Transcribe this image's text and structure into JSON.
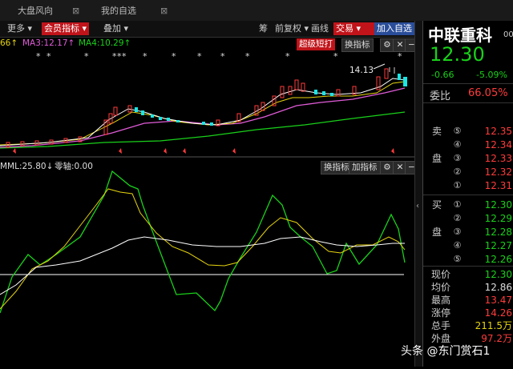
{
  "tabs": [
    {
      "label": "大盘风向",
      "close": "⊠"
    },
    {
      "label": "我的自选",
      "close": "⊠"
    }
  ],
  "toolbar": {
    "more": "更多",
    "member_indicator": "会员指标",
    "overlay": "叠加",
    "simplify": "筹",
    "restore": "前复权",
    "draw_line": "画线",
    "trade": "交易",
    "add_watch": "加入自选"
  },
  "main_chart": {
    "ma_partial": "66↑",
    "ma3": "MA3:12.17↑",
    "ma4": "MA4:10.29↑",
    "super_top": "超级短打",
    "switch_indicator": "换指标",
    "high_label": "14.13",
    "star": "*"
  },
  "indicator": {
    "mml": "MML:25.80↓",
    "zero_axis": "零轴:0.00",
    "switch_indicator": "换指标",
    "add_indicator": "加指标"
  },
  "quote": {
    "name": "中联重科",
    "code_partial": "00",
    "price": "12.30",
    "change": "-0.66",
    "change_pct": "-5.09%",
    "ratio_label": "委比",
    "ratio_value": "66.05%",
    "sell_label_1": "卖",
    "sell_label_2": "盘",
    "buy_label_1": "买",
    "buy_label_2": "盘",
    "asks": [
      {
        "level": "⑤",
        "price": "12.35"
      },
      {
        "level": "④",
        "price": "12.34"
      },
      {
        "level": "③",
        "price": "12.33"
      },
      {
        "level": "②",
        "price": "12.32"
      },
      {
        "level": "①",
        "price": "12.31"
      }
    ],
    "bids": [
      {
        "level": "①",
        "price": "12.30"
      },
      {
        "level": "②",
        "price": "12.29"
      },
      {
        "level": "③",
        "price": "12.28"
      },
      {
        "level": "④",
        "price": "12.27"
      },
      {
        "level": "⑤",
        "price": "12.26"
      }
    ],
    "stats": [
      {
        "label": "现价",
        "value": "12.30",
        "color": "#19d11a"
      },
      {
        "label": "均价",
        "value": "12.86",
        "color": "#ffffff"
      },
      {
        "label": "最高",
        "value": "13.47",
        "color": "#ff3b3b"
      },
      {
        "label": "涨停",
        "value": "14.26",
        "color": "#ff3b3b"
      },
      {
        "label": "总手",
        "value": "211.5万",
        "color": "#e6d40e"
      },
      {
        "label": "外盘",
        "value": "97.2万",
        "color": "#ff3b3b"
      }
    ]
  },
  "watermark": "头条 @东门赏石1",
  "colors": {
    "up": "#ff3b3b",
    "down": "#19d11a",
    "accent_red": "#c0141a",
    "accent_blue": "#2a4d9a"
  }
}
